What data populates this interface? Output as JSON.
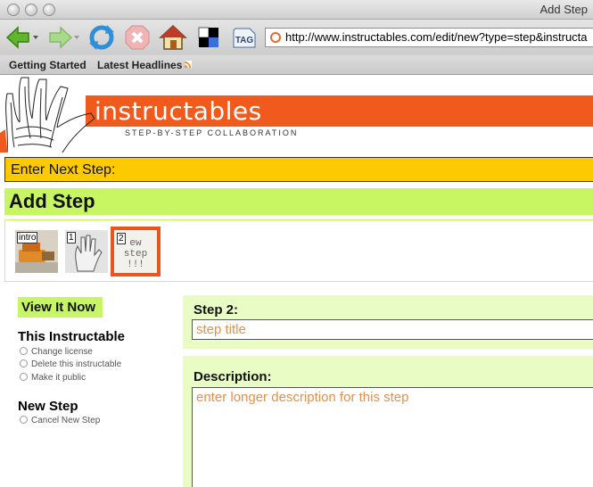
{
  "window": {
    "title": "Add Step"
  },
  "toolbar": {
    "tag_label": "TAG",
    "url": "http://www.instructables.com/edit/new?type=step&instructa"
  },
  "bookmarks": [
    {
      "label": "Getting Started"
    },
    {
      "label": "Latest Headlines"
    }
  ],
  "site": {
    "brand": "instructables",
    "tagline": "STEP-BY-STEP COLLABORATION",
    "brand_color": "#f15a1d",
    "accent_green": "#c8f564",
    "accent_yellow": "#fdc900"
  },
  "page": {
    "next_step_label": "Enter Next Step:",
    "heading": "Add Step"
  },
  "steps": [
    {
      "label": "intro"
    },
    {
      "label": "1"
    },
    {
      "label": "2",
      "text": "ew step !!!"
    }
  ],
  "sidebar": {
    "view_button": "View It Now",
    "instructable_heading": "This Instructable",
    "instructable_links": [
      "Change license",
      "Delete this instructable",
      "Make it public"
    ],
    "newstep_heading": "New Step",
    "newstep_links": [
      "Cancel New Step"
    ]
  },
  "form": {
    "step_label": "Step 2:",
    "title_placeholder": "step title",
    "description_label": "Description:",
    "description_placeholder": "enter longer description for this step"
  }
}
